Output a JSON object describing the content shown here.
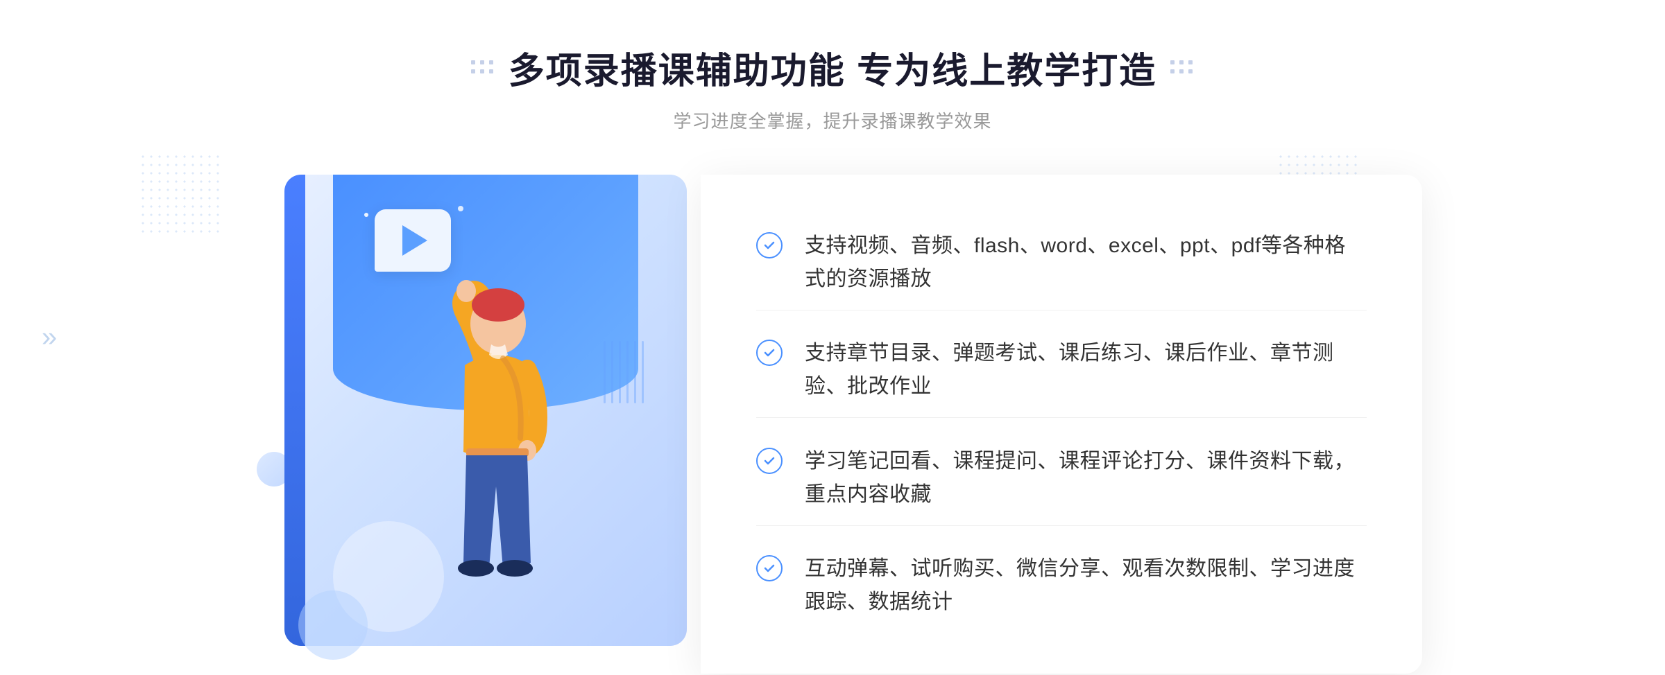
{
  "header": {
    "title": "多项录播课辅助功能 专为线上教学打造",
    "subtitle": "学习进度全掌握，提升录播课教学效果"
  },
  "features": [
    {
      "id": "feature-1",
      "text": "支持视频、音频、flash、word、excel、ppt、pdf等各种格式的资源播放"
    },
    {
      "id": "feature-2",
      "text": "支持章节目录、弹题考试、课后练习、课后作业、章节测验、批改作业"
    },
    {
      "id": "feature-3",
      "text": "学习笔记回看、课程提问、课程评论打分、课件资料下载，重点内容收藏"
    },
    {
      "id": "feature-4",
      "text": "互动弹幕、试听购买、微信分享、观看次数限制、学习进度跟踪、数据统计"
    }
  ],
  "decorations": {
    "chevron": "»",
    "check_symbol": "✓"
  }
}
